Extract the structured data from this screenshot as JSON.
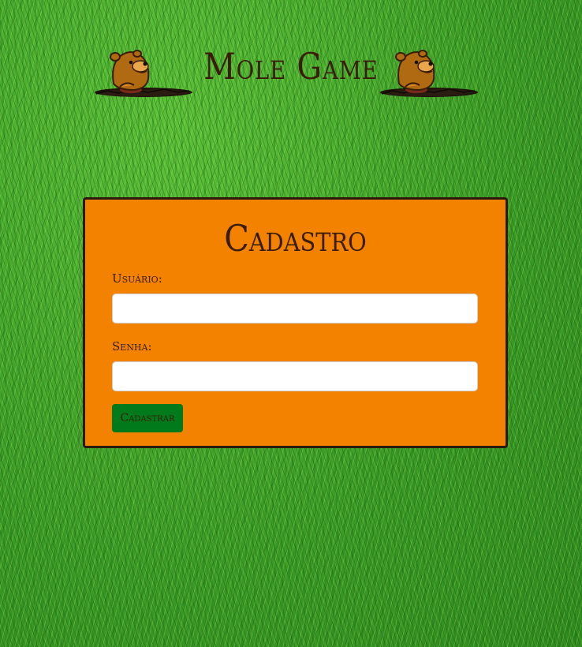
{
  "header": {
    "title": "Mole Game",
    "mascot_icon": "mole-in-hole-icon"
  },
  "form": {
    "title": "Cadastro",
    "username_label": "Usuário:",
    "username_value": "",
    "password_label": "Senha:",
    "password_value": "",
    "submit_label": "Cadastrar"
  },
  "colors": {
    "background": "#3fa62a",
    "card": "#f28200",
    "card_border": "#2b1a0d",
    "text": "#3a1d06",
    "button": "#007a1a"
  }
}
